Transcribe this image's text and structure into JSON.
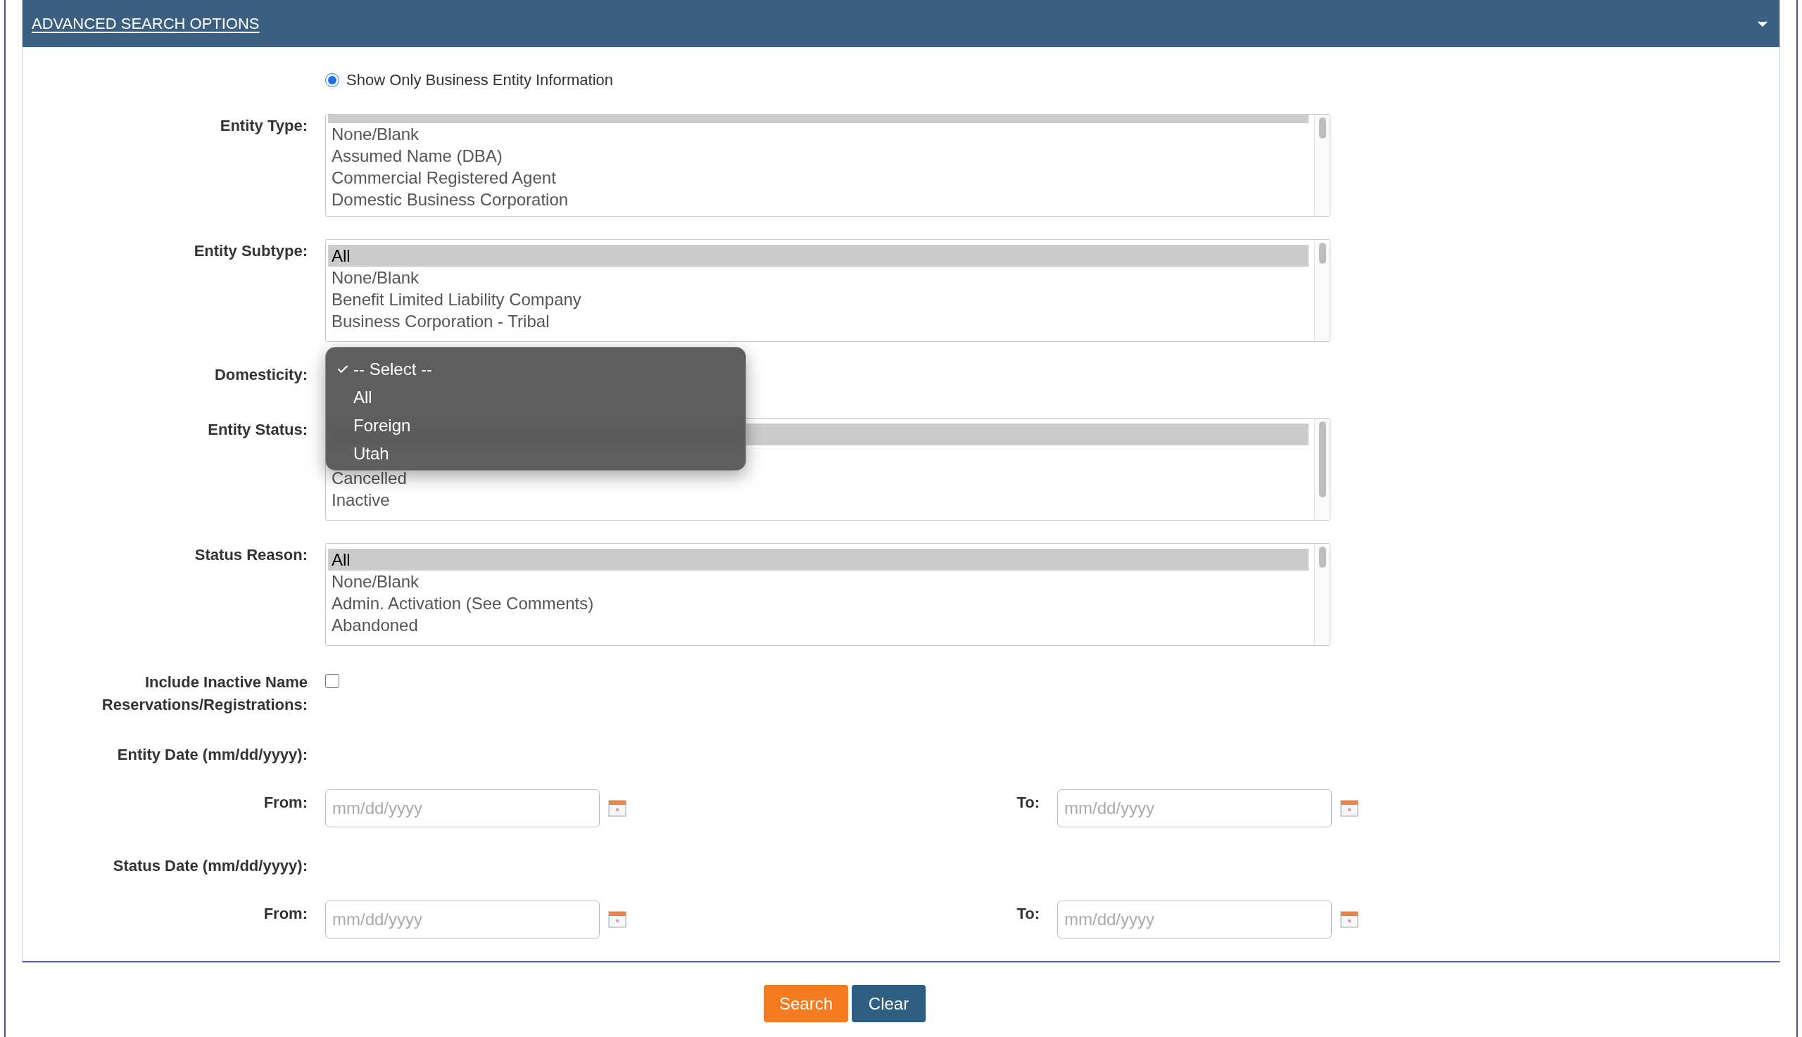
{
  "panel": {
    "title": "ADVANCED SEARCH OPTIONS",
    "expanded": true
  },
  "radio": {
    "label": "Show Only Business Entity Information",
    "selected": true
  },
  "fields": [
    {
      "kind": "listbox",
      "label": "Entity Type:",
      "options": [
        {
          "selected": true,
          "partial": true
        },
        {
          "label": "None/Blank",
          "selected": false,
          "partial": false
        },
        {
          "label": "Assumed Name (DBA)",
          "selected": false,
          "partial": false
        },
        {
          "label": "Commercial Registered Agent",
          "selected": false,
          "partial": false
        },
        {
          "label": "Domestic Business Corporation",
          "selected": false,
          "partial": false
        }
      ]
    },
    {
      "kind": "listbox",
      "label": "Entity Subtype:",
      "options": [
        {
          "label": "All",
          "selected": true,
          "partial": false
        },
        {
          "label": "None/Blank",
          "selected": false,
          "partial": false
        },
        {
          "label": "Benefit Limited Liability Company",
          "selected": false,
          "partial": false
        },
        {
          "label": "Business Corporation - Tribal",
          "selected": false,
          "partial": false
        }
      ]
    },
    {
      "kind": "select",
      "label": "Domesticity:",
      "options": [
        {
          "label": "-- Select --",
          "selected": true
        },
        {
          "label": "All",
          "selected": false
        },
        {
          "label": "Foreign",
          "selected": false
        },
        {
          "label": "Utah",
          "selected": false
        }
      ]
    },
    {
      "kind": "listbox",
      "label": "Entity Status:",
      "options": [
        {
          "selected": true,
          "partial": false
        },
        {
          "selected": false,
          "partial": false
        },
        {
          "label": "Cancelled",
          "selected": false,
          "partial": false
        },
        {
          "label": "Inactive",
          "selected": false,
          "partial": false
        }
      ]
    },
    {
      "kind": "listbox",
      "label": "Status Reason:",
      "options": [
        {
          "label": "All",
          "selected": true,
          "partial": false
        },
        {
          "label": "None/Blank",
          "selected": false,
          "partial": false
        },
        {
          "label": "Admin. Activation (See Comments)",
          "selected": false,
          "partial": false
        },
        {
          "label": "Abandoned",
          "selected": false,
          "partial": false
        }
      ]
    },
    {
      "kind": "checkbox",
      "label": "Include Inactive Name Reservations/Registrations:",
      "checked": false
    },
    {
      "kind": "heading",
      "label": "Entity Date (mm/dd/yyyy):"
    },
    {
      "kind": "date_range",
      "from_label": "From:",
      "from_placeholder": "mm/dd/yyyy",
      "to_label": "To:",
      "to_placeholder": "mm/dd/yyyy"
    },
    {
      "kind": "heading",
      "label": "Status Date (mm/dd/yyyy):"
    },
    {
      "kind": "date_range",
      "from_label": "From:",
      "from_placeholder": "mm/dd/yyyy",
      "to_label": "To:",
      "to_placeholder": "mm/dd/yyyy"
    }
  ],
  "buttons": [
    {
      "label": "Search",
      "kind": "primary"
    },
    {
      "label": "Clear",
      "kind": "secondary"
    }
  ]
}
